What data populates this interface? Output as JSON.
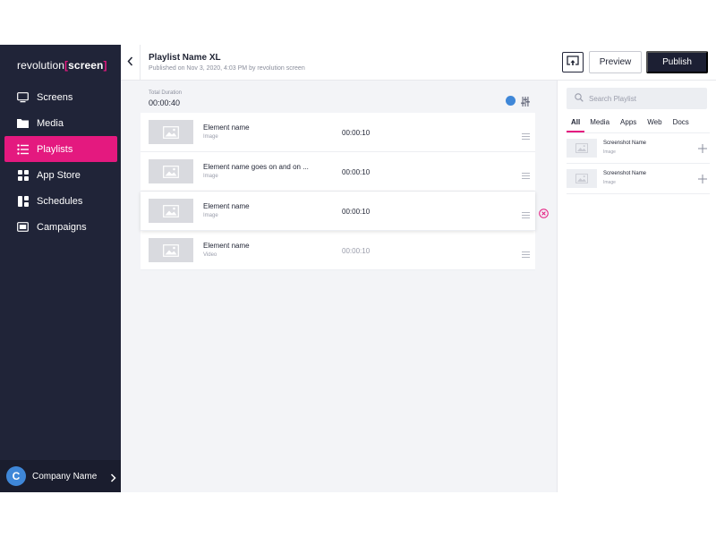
{
  "sidebar": {
    "logo_prefix": "revolution",
    "logo_bracket_open": "[",
    "logo_word": "screen",
    "logo_bracket_close": "]",
    "items": [
      {
        "label": "Screens",
        "icon": "monitor-icon"
      },
      {
        "label": "Media",
        "icon": "folder-icon"
      },
      {
        "label": "Playlists",
        "icon": "playlist-icon",
        "active": true
      },
      {
        "label": "App Store",
        "icon": "grid-icon"
      },
      {
        "label": "Schedules",
        "icon": "schedule-icon"
      },
      {
        "label": "Campaigns",
        "icon": "campaign-icon"
      }
    ],
    "company": {
      "initial": "C",
      "name": "Company Name"
    }
  },
  "header": {
    "title": "Playlist Name XL",
    "subtitle": "Published on Nov 3, 2020, 4:03 PM by revolution screen",
    "preview_label": "Preview",
    "publish_label": "Publish"
  },
  "main": {
    "duration_label": "Total Duration",
    "duration_value": "00:00:40",
    "elements": [
      {
        "name": "Element name",
        "type": "Image",
        "time": "00:00:10"
      },
      {
        "name": "Element name goes on and on ...",
        "type": "Image",
        "time": "00:00:10"
      },
      {
        "name": "Element name",
        "type": "Image",
        "time": "00:00:10"
      },
      {
        "name": "Element name",
        "type": "Video",
        "time": "00:00:10"
      }
    ]
  },
  "panel": {
    "search_placeholder": "Search Playlist",
    "tabs": [
      "All",
      "Media",
      "Apps",
      "Web",
      "Docs"
    ],
    "items": [
      {
        "name": "Screenshot Name",
        "type": "Image"
      },
      {
        "name": "Screenshot Name",
        "type": "Image"
      }
    ]
  },
  "colors": {
    "sidebar_bg": "#202438",
    "accent": "#e4197f",
    "publish_bg": "#1c1f33",
    "blue": "#3f87d8"
  }
}
